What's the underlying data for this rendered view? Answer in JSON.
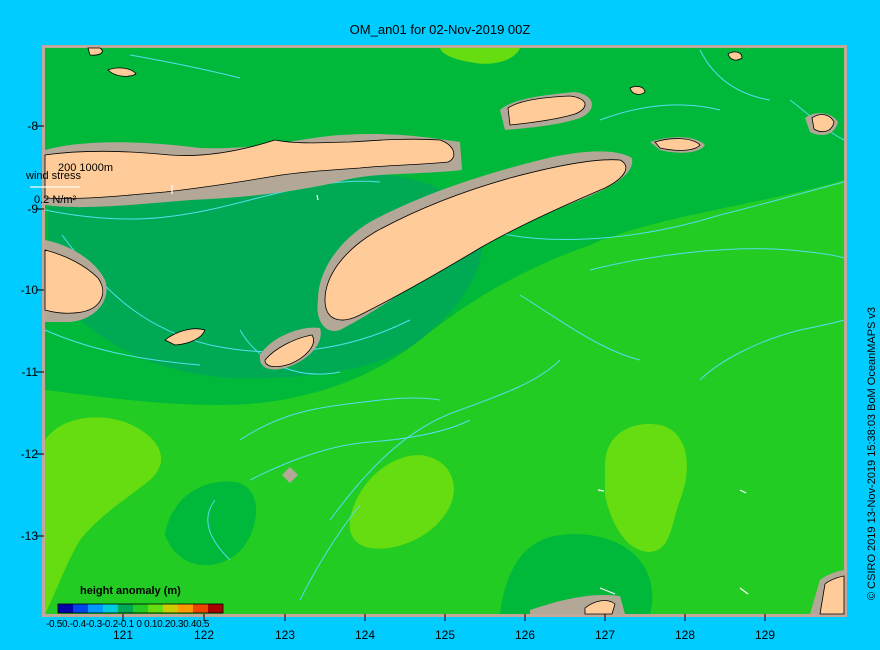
{
  "title": "OM_an01 for 02-Nov-2019 00Z",
  "credit": "© CSIRO 2019  13-Nov-2019 15:38:03 BoM OceanMAPS v3",
  "wind": {
    "isobath_label": "200  1000m",
    "stress_label": "wind stress",
    "scale_label": "0.2 N/m²"
  },
  "legend": {
    "title": "height anomaly (m)",
    "ticks_text": "-0.50.-0.4-0.3-0.2-0.1 0 0.10.20.30.40.5"
  },
  "axes": {
    "x_ticks": [
      "121",
      "122",
      "123",
      "124",
      "125",
      "126",
      "127",
      "128",
      "129"
    ],
    "y_ticks": [
      "-8",
      "-9",
      "-10",
      "-11",
      "-12",
      "-13"
    ]
  },
  "colors": {
    "background": "#00ccff",
    "frame": "#c0a99a",
    "land": "#ffcc99",
    "shelf": "#b3a898",
    "anom_low": "#00aa55",
    "anom_mid": "#00b93b",
    "anom_zero": "#22cc22",
    "anom_pos": "#66dd11",
    "contour": "#55ddee"
  }
}
